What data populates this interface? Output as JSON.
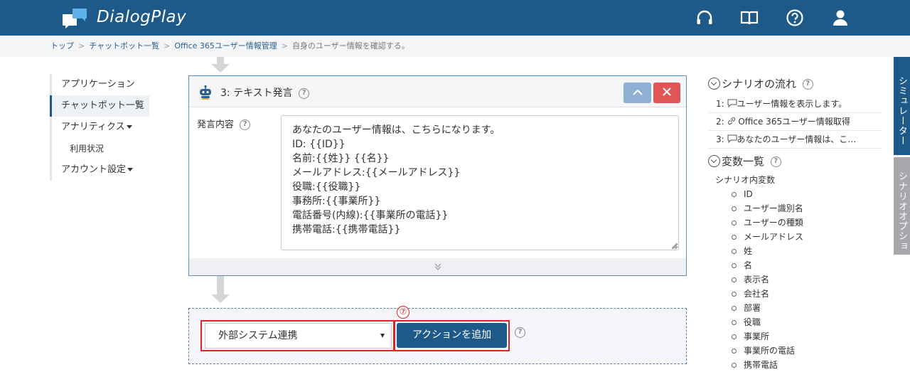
{
  "app": {
    "brand": "DialogPlay"
  },
  "header": {
    "icons": [
      "headset-icon",
      "book-icon",
      "help-icon",
      "user-icon"
    ]
  },
  "breadcrumb": {
    "items": [
      "トップ",
      "チャットボット一覧",
      "Office 365ユーザー情報管理"
    ],
    "current": "自身のユーザー情報を確認する。"
  },
  "leftnav": {
    "items": [
      {
        "label": "アプリケーション"
      },
      {
        "label": "チャットボット一覧"
      },
      {
        "label": "アナリティクス"
      },
      {
        "label": "利用状況"
      },
      {
        "label": "アカウント設定"
      }
    ]
  },
  "step": {
    "title": "3: テキスト発言",
    "field_label": "発言内容",
    "content": "あなたのユーザー情報は、こちらになります。\nID: {{ID}}\n名前:{{姓}} {{名}}\nメールアドレス:{{メールアドレス}}\n役職:{{役職}}\n事務所:{{事業所}}\n電話番号(内線):{{事業所の電話}}\n携帯電話:{{携帯電話}}"
  },
  "add_action": {
    "selected": "外部システム連携",
    "button_label": "アクションを追加",
    "annotation": "⑦"
  },
  "scenario_flow": {
    "title": "シナリオの流れ",
    "items": [
      {
        "num": "1:",
        "text": "ユーザー情報を表示します。"
      },
      {
        "num": "2:",
        "text": "Office 365ユーザー情報取得"
      },
      {
        "num": "3:",
        "text": "あなたのユーザー情報は、こ…"
      }
    ]
  },
  "variables": {
    "title": "変数一覧",
    "group": "シナリオ内変数",
    "items": [
      "ID",
      "ユーザー識別名",
      "ユーザーの種類",
      "メールアドレス",
      "姓",
      "名",
      "表示名",
      "会社名",
      "部署",
      "役職",
      "事業所",
      "事業所の電話",
      "携帯電話"
    ]
  },
  "side_tabs": {
    "simulator": "シミュレーター",
    "scenario_options": "シナリオオプション"
  },
  "colors": {
    "header": "#1d5a8a",
    "accent": "#1d5a8a",
    "close": "#e05555",
    "highlight": "#e02424"
  }
}
